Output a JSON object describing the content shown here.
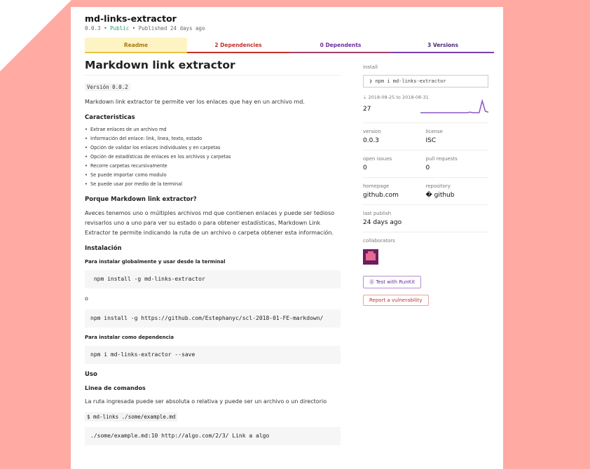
{
  "package": {
    "name": "md-links-extractor",
    "version_meta": "0.0.3",
    "separator": "•",
    "visibility": "Public",
    "published": "Published 24 days ago"
  },
  "tabs": [
    {
      "label": "Readme"
    },
    {
      "label": "2  Dependencies"
    },
    {
      "label": "0  Dependents"
    },
    {
      "label": "3  Versions"
    }
  ],
  "readme": {
    "title": "Markdown link extractor",
    "version_code": "Versión 0.0.2",
    "intro": "Markdown link extractor te permite ver los enlaces que hay en un archivo md.",
    "features_heading": "Caracteristicas",
    "features": [
      "Extrae enlaces de un archivo md",
      "Información del enlace: link, linea, texto, estado",
      "Opción de validar los enlaces individuales y en carpetas",
      "Opción de estadísticas de enlaces en los archivos y carpetas",
      "Recorre carpetas recursivamente",
      "Se puede importar como modulo",
      "Se puede usar por medio de la terminal"
    ],
    "why_heading": "Porque Markdown link extractor?",
    "why_text": "Aveces tenemos uno o múltiples archivos md que contienen enlaces y puede ser tedioso revisarlos uno a uno para ver su estado o para obtener estadísticas, Markdown Link Extractor te permite indicando la ruta de un archivo o carpeta obtener esta información.",
    "install_heading": "Instalación",
    "global_heading": "Para instalar globalmente y usar desde la terminal",
    "global_cmd": " npm install -g md-links-extractor",
    "or_text": "o",
    "github_cmd": "npm install -g https://github.com/Estephanyc/scl-2018-01-FE-markdown/",
    "dep_heading": "Para instalar como dependencia",
    "dep_cmd": "npm i md-links-extractor --save",
    "uso_heading": "Uso",
    "cli_heading": "Linea de comandos",
    "path_text": "La ruta ingresada puede ser absoluta o relativa y puede ser un archivo o un directorio",
    "example_cmd": "$ md-links ./some/example.md",
    "example_output": "./some/example.md:10 http://algo.com/2/3/ Link a algo"
  },
  "sidebar": {
    "install_label": "install",
    "install_cmd": "npm i md-links-extractor",
    "install_prompt": "❯",
    "downloads_range": "2018-08-25 to 2018-08-31",
    "downloads_icon": "download-icon",
    "downloads_count": "27",
    "downloads_series": [
      0,
      0,
      0,
      0,
      0,
      0,
      0,
      0,
      0,
      0,
      0,
      0,
      0,
      0,
      0,
      0,
      1,
      0,
      0,
      0,
      24,
      3,
      1
    ],
    "accent_color": "#8956c3",
    "version_label": "version",
    "version_value": "0.0.3",
    "license_label": "license",
    "license_value": "ISC",
    "issues_label": "open issues",
    "issues_value": "0",
    "pulls_label": "pull requests",
    "pulls_value": "0",
    "homepage_label": "homepage",
    "homepage_value": "github.com",
    "repo_label": "repository",
    "repo_icon": "git-icon",
    "repo_value": "github",
    "repo_glyph": "�",
    "last_publish_label": "last publish",
    "last_publish_value": "24 days ago",
    "collaborators_label": "collaborators",
    "runkit_label": "Test with RunKit",
    "vuln_label": "Report a vulnerability"
  }
}
